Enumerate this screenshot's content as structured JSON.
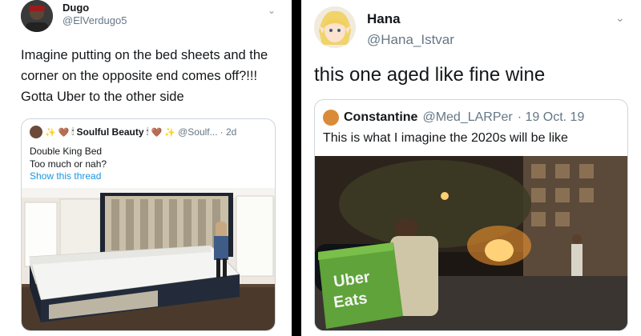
{
  "left": {
    "author": {
      "name": "Dugo",
      "handle": "@ElVerdugo5"
    },
    "tweet_text": "Imagine putting on the bed sheets and the corner on the opposite end comes off?!!! Gotta Uber to the other side",
    "quote": {
      "name": "Soulful Beauty",
      "handle": "@Soulf...",
      "time": "· 2d",
      "text_line1": "Double King Bed",
      "text_line2": "Too much or nah?",
      "show_thread": "Show this thread"
    }
  },
  "right": {
    "author": {
      "name": "Hana",
      "handle": "@Hana_Istvar"
    },
    "tweet_text": "this one aged like fine wine",
    "quote": {
      "name": "Constantine",
      "handle": "@Med_LARPer",
      "time": "· 19 Oct. 19",
      "text": "This is what I imagine the 2020s will be like"
    },
    "photo_signage": {
      "line1": "Uber",
      "line2": "Eats"
    }
  },
  "icons": {
    "chevron": "chevron-down-icon"
  }
}
